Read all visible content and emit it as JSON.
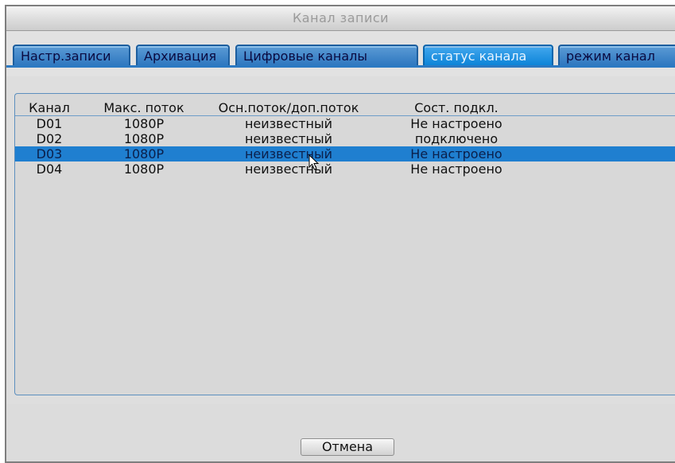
{
  "window": {
    "title": "Канал записи"
  },
  "tabs": [
    {
      "label": "Настр.записи",
      "active": false
    },
    {
      "label": "Архивация",
      "active": false
    },
    {
      "label": "Цифровые каналы",
      "active": false
    },
    {
      "label": "статус канала",
      "active": true
    },
    {
      "label": "режим канал",
      "active": false
    }
  ],
  "table": {
    "headers": [
      "Канал",
      "Макс. поток",
      "Осн.поток/доп.поток",
      "Сост. подкл."
    ],
    "rows": [
      [
        "D01",
        "1080P",
        "неизвестный",
        "Не настроено"
      ],
      [
        "D02",
        "1080P",
        "неизвестный",
        "подключено"
      ],
      [
        "D03",
        "1080P",
        "неизвестный",
        "Не настроено"
      ],
      [
        "D04",
        "1080P",
        "неизвестный",
        "Не настроено"
      ]
    ],
    "selected_row": 2
  },
  "footer": {
    "cancel_label": "Отмена"
  },
  "colors": {
    "tab": "#2f78c0",
    "tab_active": "#0d84d8",
    "selection": "#1f7fd0",
    "window_bg": "#dedede"
  },
  "icons": {
    "pointer": "mouse-cursor-icon"
  }
}
